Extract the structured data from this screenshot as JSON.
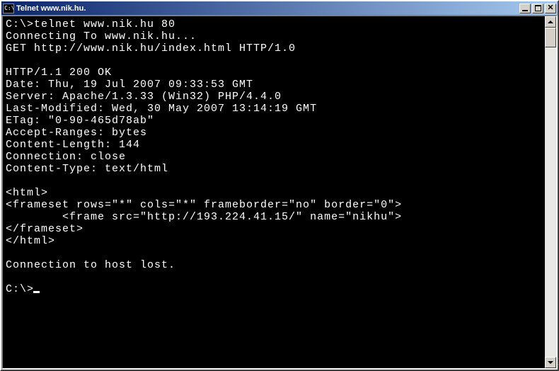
{
  "titlebar": {
    "icon_text": "C:\\",
    "title": "Telnet www.nik.hu."
  },
  "terminal": {
    "lines": [
      "C:\\>telnet www.nik.hu 80",
      "Connecting To www.nik.hu...",
      "GET http://www.nik.hu/index.html HTTP/1.0",
      "",
      "HTTP/1.1 200 OK",
      "Date: Thu, 19 Jul 2007 09:33:53 GMT",
      "Server: Apache/1.3.33 (Win32) PHP/4.4.0",
      "Last-Modified: Wed, 30 May 2007 13:14:19 GMT",
      "ETag: \"0-90-465d78ab\"",
      "Accept-Ranges: bytes",
      "Content-Length: 144",
      "Connection: close",
      "Content-Type: text/html",
      "",
      "<html>",
      "<frameset rows=\"*\" cols=\"*\" frameborder=\"no\" border=\"0\">",
      "        <frame src=\"http://193.224.41.15/\" name=\"nikhu\">",
      "</frameset>",
      "</html>",
      "",
      "Connection to host lost.",
      "",
      "C:\\>"
    ]
  }
}
